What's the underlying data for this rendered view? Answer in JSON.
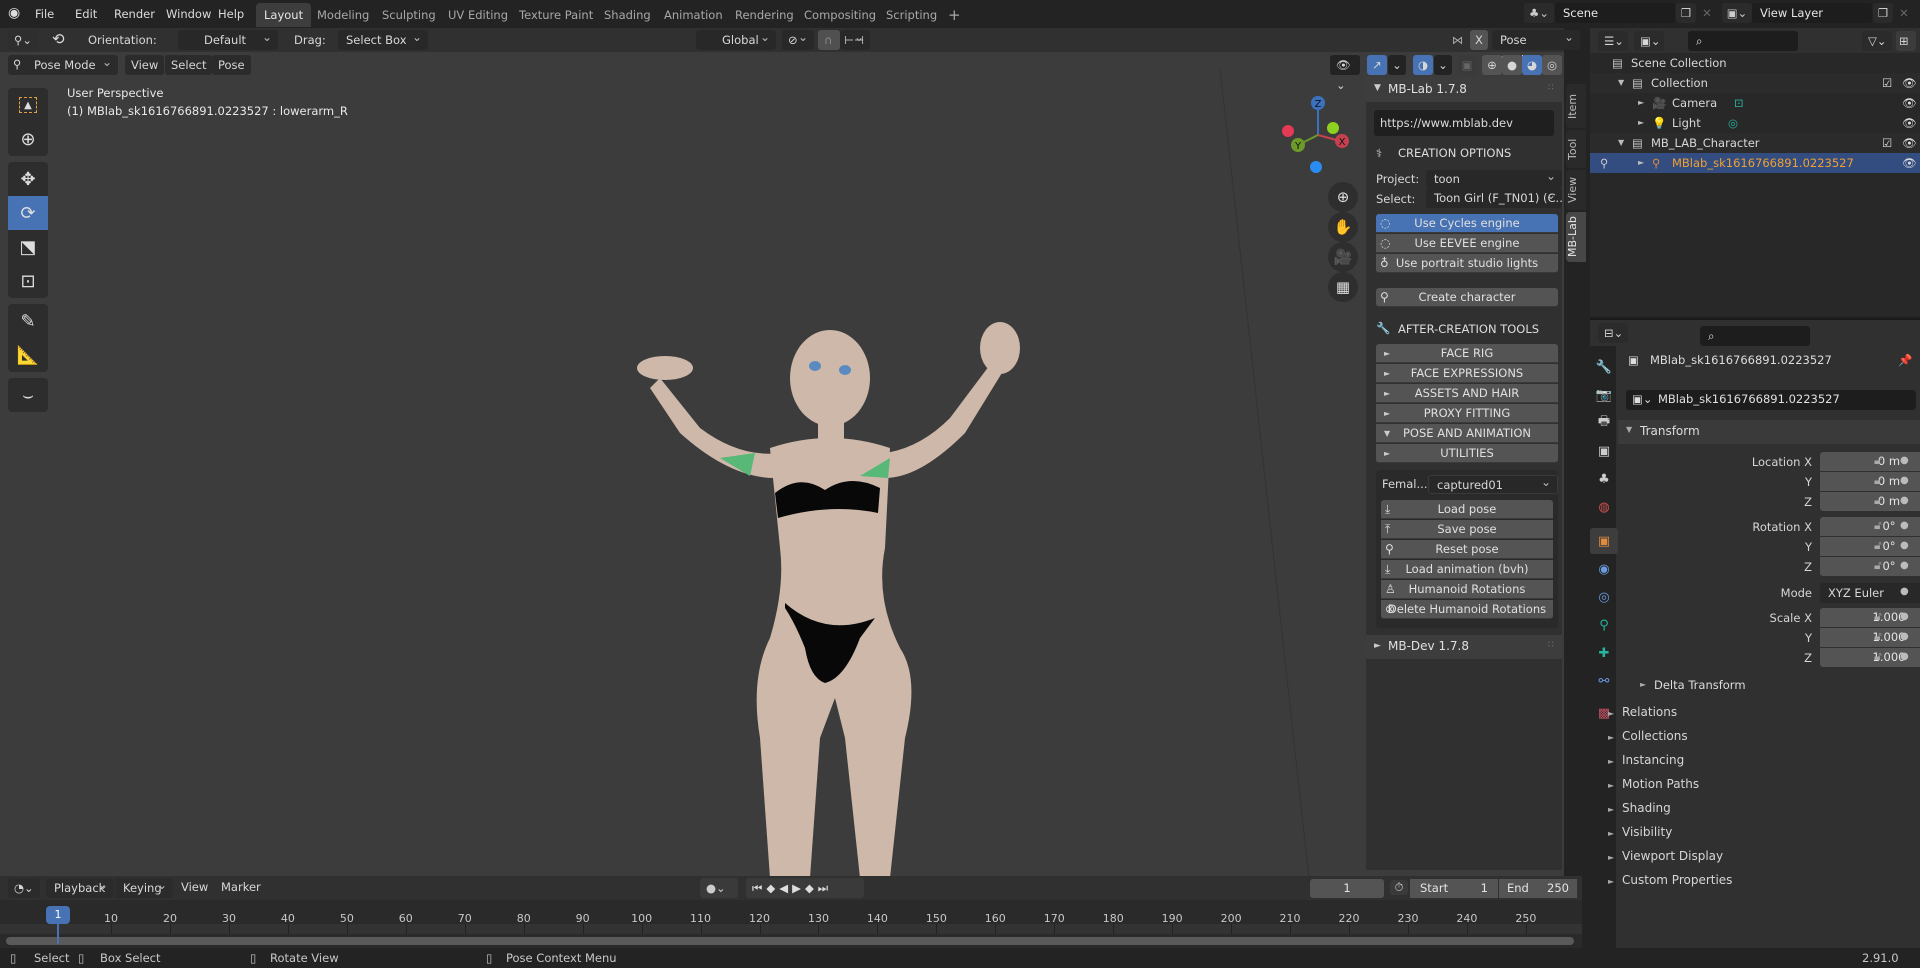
{
  "topbar": {
    "menus": [
      "File",
      "Edit",
      "Render",
      "Window",
      "Help"
    ],
    "workspaces": [
      "Layout",
      "Modeling",
      "Sculpting",
      "UV Editing",
      "Texture Paint",
      "Shading",
      "Animation",
      "Rendering",
      "Compositing",
      "Scripting"
    ],
    "active_workspace": "Layout",
    "add_tab": "+",
    "scene": "Scene",
    "view_layer": "View Layer"
  },
  "tool_header": {
    "orientation_label": "Orientation:",
    "orientation_value": "Default",
    "drag_label": "Drag:",
    "drag_value": "Select Box",
    "transform_orientation": "Global",
    "pose_options": "Pose Options",
    "x_mirror": "X"
  },
  "viewport_header": {
    "mode": "Pose Mode",
    "menus": [
      "View",
      "Select",
      "Pose"
    ]
  },
  "viewport": {
    "perspective": "User Perspective",
    "object_info": "(1) MBlab_sk1616766891.0223527 : lowerarm_R",
    "gizmo_axes": [
      "X",
      "Y",
      "Z"
    ],
    "axis_colors": {
      "x": "#c6404e",
      "y": "#6d9a29",
      "z": "#3b72c0"
    }
  },
  "sidebar_tabs": [
    "Item",
    "Tool",
    "View",
    "MB-Lab"
  ],
  "active_sidebar_tab": "MB-Lab",
  "mblab": {
    "title": "MB-Lab 1.7.8",
    "url": "https://www.mblab.dev",
    "creation_options": "CREATION OPTIONS",
    "project_label": "Project:",
    "project_value": "toon",
    "select_label": "Select:",
    "select_value": "Toon Girl (F_TN01) (C...",
    "engines": [
      {
        "label": "Use Cycles engine",
        "active": true
      },
      {
        "label": "Use EEVEE engine",
        "active": false
      },
      {
        "label": "Use portrait studio lights",
        "active": false
      }
    ],
    "create_character": "Create character",
    "after_creation": "AFTER-CREATION TOOLS",
    "tool_sections": [
      {
        "label": "FACE RIG",
        "expanded": false
      },
      {
        "label": "FACE EXPRESSIONS",
        "expanded": false
      },
      {
        "label": "ASSETS AND HAIR",
        "expanded": false
      },
      {
        "label": "PROXY FITTING",
        "expanded": false
      },
      {
        "label": "POSE AND ANIMATION",
        "expanded": true
      },
      {
        "label": "UTILITIES",
        "expanded": false
      }
    ],
    "pose_label": "Femal...",
    "pose_value": "captured01",
    "pose_buttons": [
      "Load pose",
      "Save pose",
      "Reset pose",
      "Load animation (bvh)",
      "Humanoid Rotations",
      "Delete Humanoid Rotations"
    ],
    "dev_title": "MB-Dev 1.7.8"
  },
  "outliner": {
    "rows": [
      {
        "label": "Scene Collection",
        "level": 0
      },
      {
        "label": "Collection",
        "level": 1
      },
      {
        "label": "Camera",
        "level": 2
      },
      {
        "label": "Light",
        "level": 2
      },
      {
        "label": "MB_LAB_Character",
        "level": 1
      },
      {
        "label": "MBlab_sk1616766891.0223527",
        "level": 2,
        "selected": true
      }
    ]
  },
  "properties": {
    "object_name": "MBlab_sk1616766891.0223527",
    "object_field": "MBlab_sk1616766891.0223527",
    "transform_title": "Transform",
    "location": {
      "label": "Location X",
      "values": [
        "0 m",
        "0 m",
        "0 m"
      ]
    },
    "rotation": {
      "label": "Rotation X",
      "values": [
        "0°",
        "0°",
        "0°"
      ]
    },
    "mode_label": "Mode",
    "mode_value": "XYZ Euler",
    "scale": {
      "label": "Scale X",
      "values": [
        "1.000",
        "1.000",
        "1.000"
      ]
    },
    "axis_labels": [
      "Y",
      "Z"
    ],
    "delta_transform": "Delta Transform",
    "sections": [
      "Relations",
      "Collections",
      "Instancing",
      "Motion Paths",
      "Shading",
      "Visibility",
      "Viewport Display",
      "Custom Properties"
    ]
  },
  "timeline": {
    "menus": [
      "Playback",
      "Keying",
      "View",
      "Marker"
    ],
    "current_frame": "1",
    "start_label": "Start",
    "start": "1",
    "end_label": "End",
    "end": "250",
    "ticks": [
      "10",
      "20",
      "30",
      "40",
      "50",
      "60",
      "70",
      "80",
      "90",
      "100",
      "110",
      "120",
      "130",
      "140",
      "150",
      "160",
      "170",
      "180",
      "190",
      "200",
      "210",
      "220",
      "230",
      "240",
      "250"
    ],
    "playhead": "1"
  },
  "statusbar": {
    "hints": [
      "Select",
      "Box Select",
      "Rotate View",
      "Pose Context Menu"
    ],
    "version": "2.91.0"
  }
}
